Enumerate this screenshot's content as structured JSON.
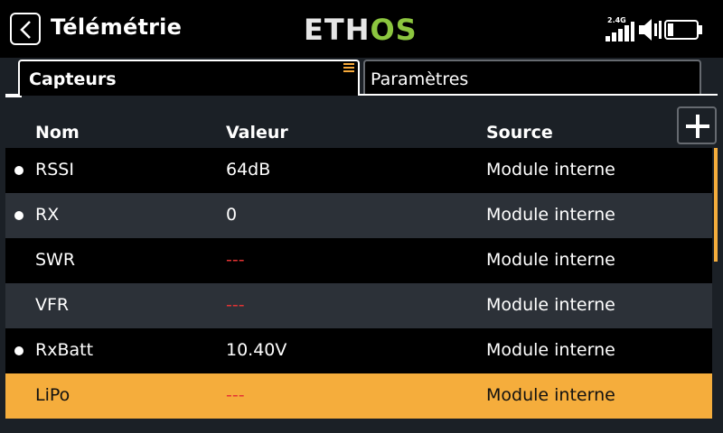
{
  "header": {
    "title": "Télémétrie",
    "logo_left": "ETH",
    "logo_right": "OS",
    "rf_band": "2.4G",
    "icons": {
      "back": "back-arrow-icon",
      "signal": "signal-bars-icon",
      "speaker": "speaker-icon",
      "battery": "battery-icon"
    }
  },
  "tabs": [
    {
      "label": "Capteurs",
      "active": true
    },
    {
      "label": "Paramètres",
      "active": false
    }
  ],
  "table": {
    "columns": [
      "Nom",
      "Valeur",
      "Source"
    ],
    "rows": [
      {
        "name": "RSSI",
        "value": "64dB",
        "source": "Module interne",
        "active": true
      },
      {
        "name": "RX",
        "value": "0",
        "source": "Module interne",
        "active": true
      },
      {
        "name": "SWR",
        "value": "---",
        "source": "Module interne",
        "active": false
      },
      {
        "name": "VFR",
        "value": "---",
        "source": "Module interne",
        "active": false
      },
      {
        "name": "RxBatt",
        "value": "10.40V",
        "source": "Module interne",
        "active": true
      },
      {
        "name": "LiPo",
        "value": "---",
        "source": "Module interne",
        "active": false,
        "selected": true
      }
    ]
  },
  "colors": {
    "accent": "#f5ad3c",
    "no_value": "#e53333",
    "logo_green": "#8cc63f"
  }
}
